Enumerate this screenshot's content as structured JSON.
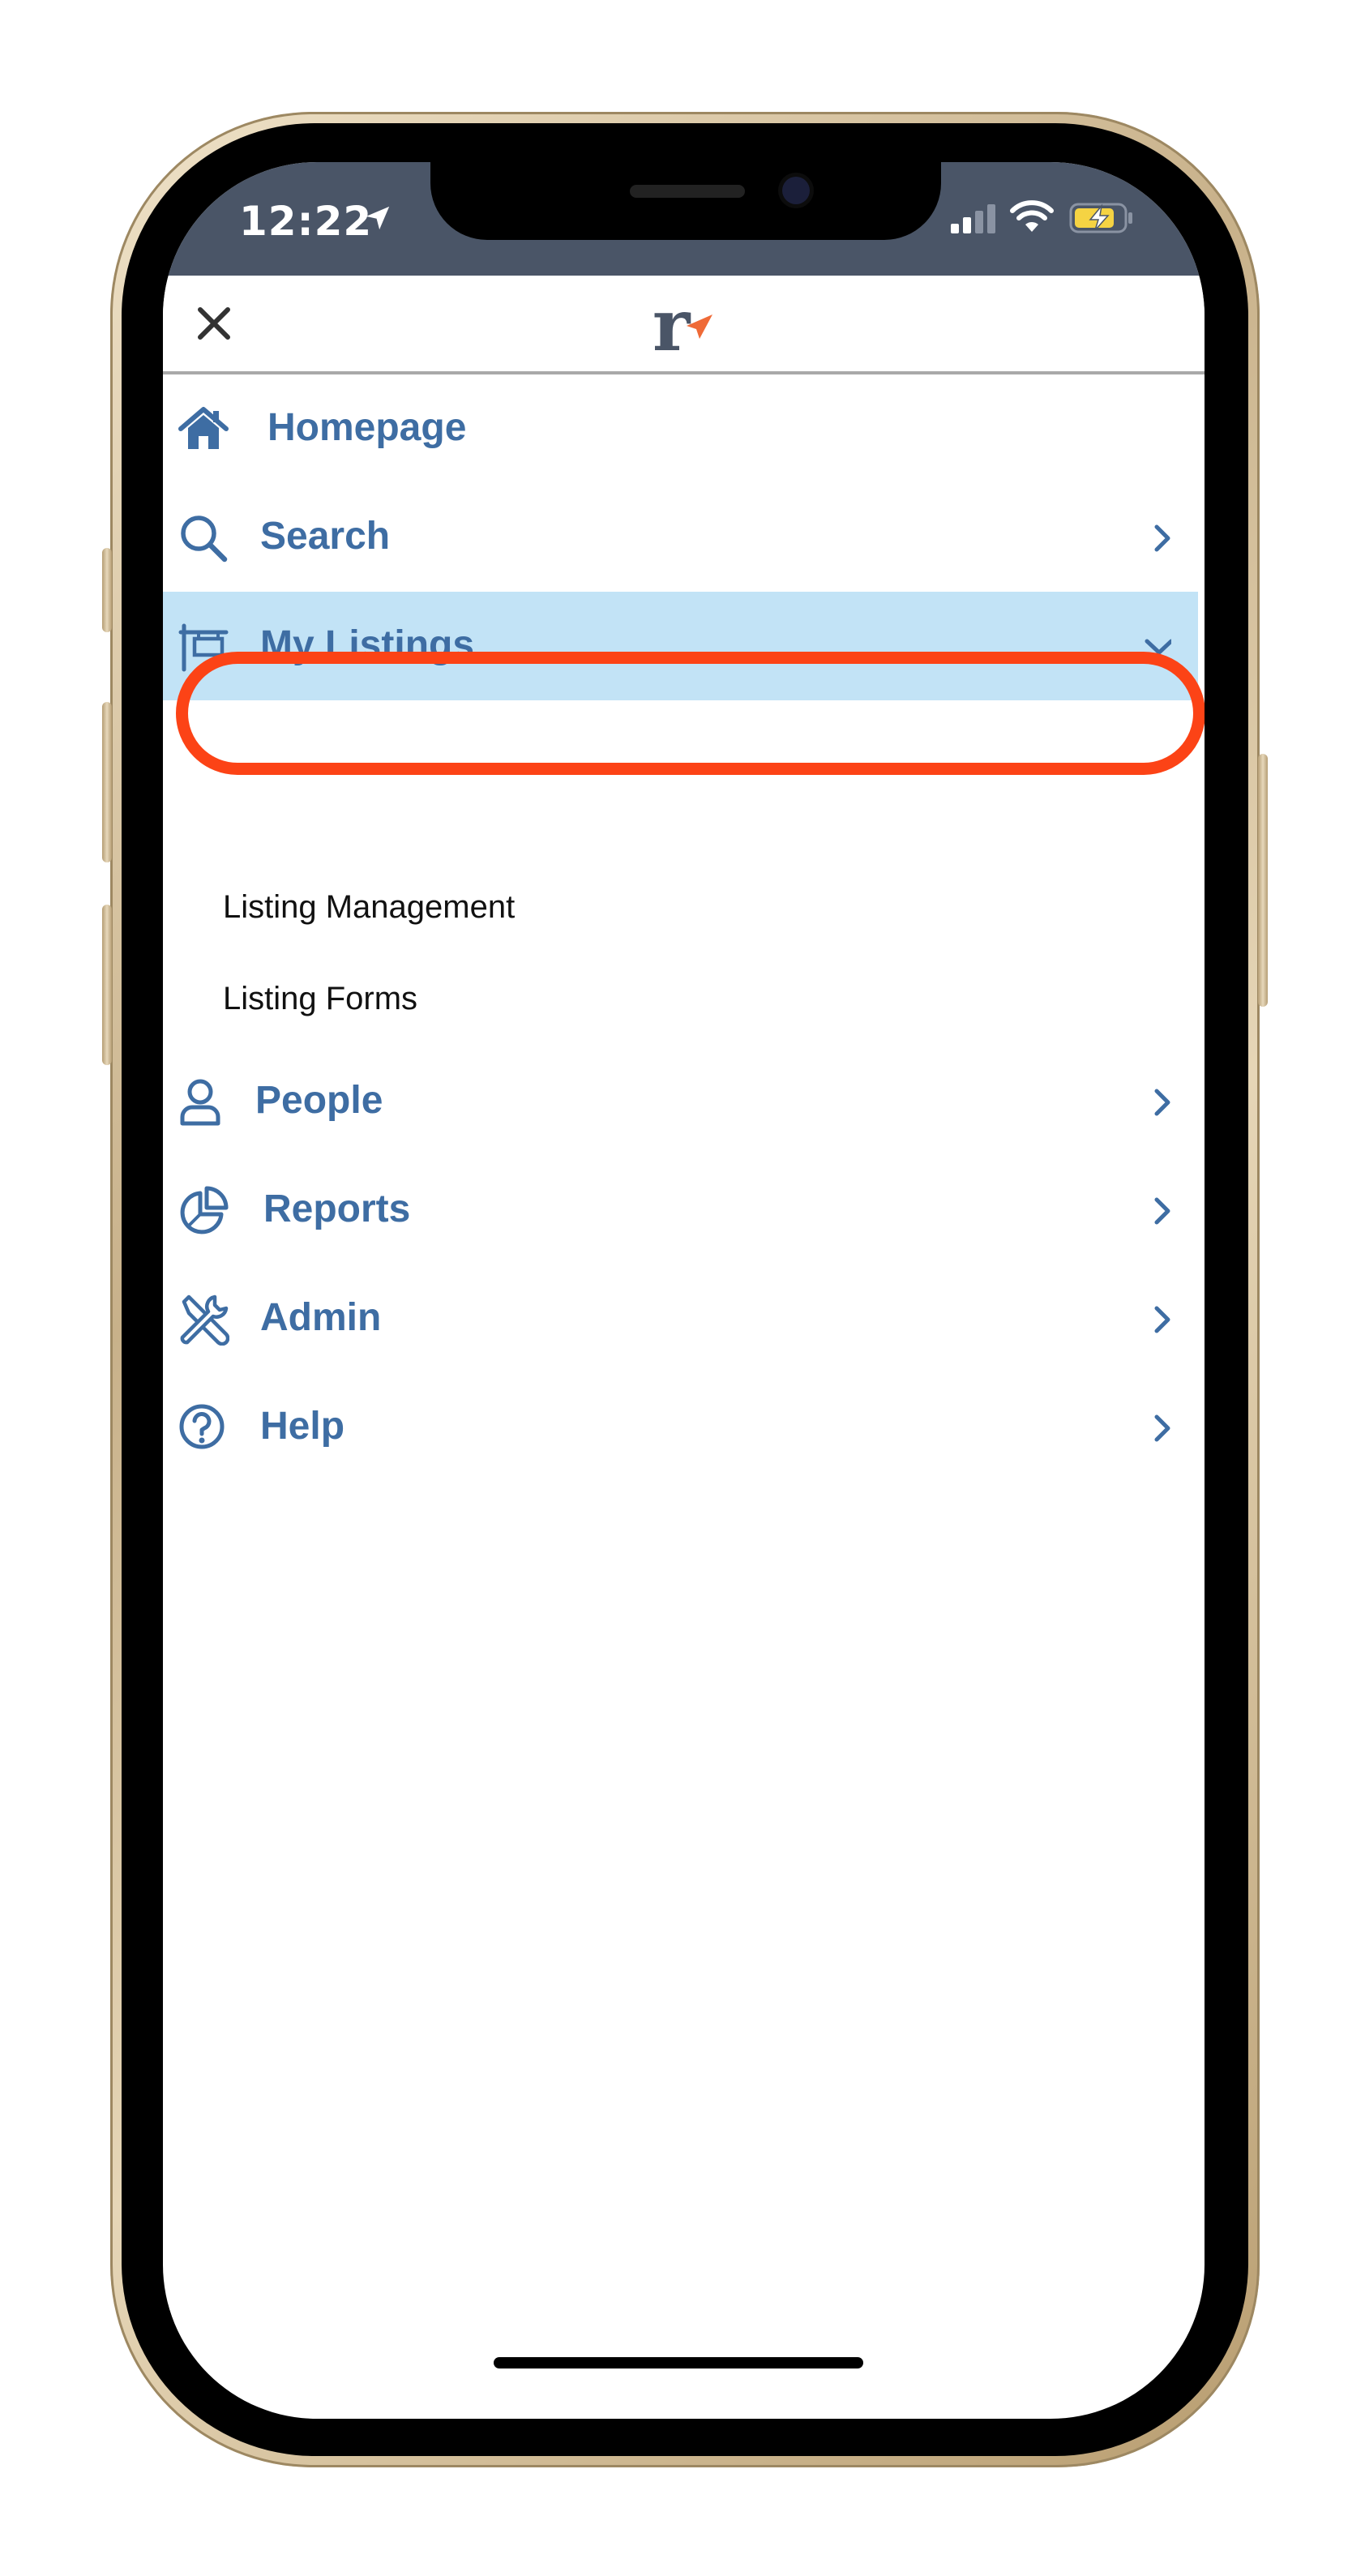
{
  "status_bar": {
    "time": "12:22",
    "icons": [
      "location-arrow-icon",
      "cellular-signal-icon",
      "wifi-icon",
      "battery-charging-icon"
    ],
    "battery_color": "#f5d343"
  },
  "header": {
    "close_icon": "close-icon",
    "logo_letter": "r",
    "logo_colors": {
      "letter": "#4a5567",
      "arrow": "#ef6a37"
    }
  },
  "menu": {
    "items": [
      {
        "id": "homepage",
        "label": "Homepage",
        "icon": "home-icon",
        "chevron": "none",
        "active": false
      },
      {
        "id": "search",
        "label": "Search",
        "icon": "search-icon",
        "chevron": "right",
        "active": false
      },
      {
        "id": "my-listings",
        "label": "My Listings",
        "icon": "listing-sign-icon",
        "chevron": "down",
        "active": true,
        "children": [
          {
            "id": "listing-management",
            "label": "Listing Management",
            "highlighted": true
          },
          {
            "id": "listing-forms",
            "label": "Listing Forms",
            "highlighted": false
          }
        ]
      },
      {
        "id": "people",
        "label": "People",
        "icon": "person-icon",
        "chevron": "right",
        "active": false
      },
      {
        "id": "reports",
        "label": "Reports",
        "icon": "pie-chart-icon",
        "chevron": "right",
        "active": false
      },
      {
        "id": "admin",
        "label": "Admin",
        "icon": "tools-icon",
        "chevron": "right",
        "active": false
      },
      {
        "id": "help",
        "label": "Help",
        "icon": "help-circle-icon",
        "chevron": "right",
        "active": false
      }
    ]
  },
  "colors": {
    "menu_text": "#3e6da3",
    "active_background": "#c2e3f6",
    "highlight_ring": "#fc4316",
    "status_bar_background": "#4a5567"
  }
}
